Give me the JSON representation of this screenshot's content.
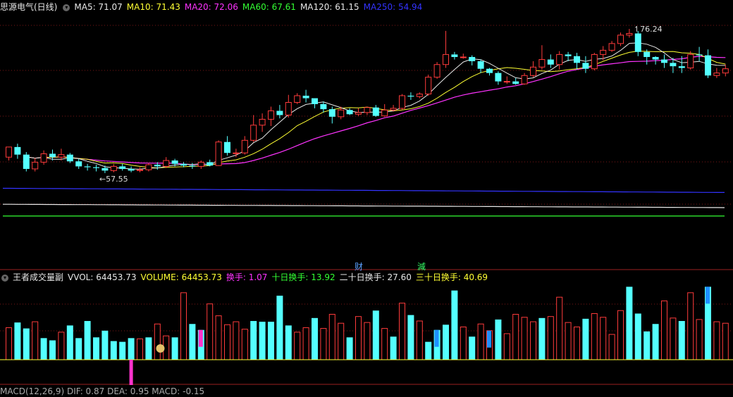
{
  "header": {
    "title": "思源电气(日线)",
    "ma": [
      {
        "label": "MA5: 71.07",
        "color": "#e8e8e8"
      },
      {
        "label": "MA10: 71.43",
        "color": "#ffff33"
      },
      {
        "label": "MA20: 72.06",
        "color": "#ff33ff"
      },
      {
        "label": "MA60: 67.61",
        "color": "#33ff33"
      },
      {
        "label": "MA120: 61.15",
        "color": "#e8e8e8"
      },
      {
        "label": "MA250: 54.94",
        "color": "#3333ff"
      }
    ]
  },
  "indicator": {
    "name": "王者成交量副",
    "items": [
      {
        "label": "VVOL: 64453.73",
        "color": "#e8e8e8"
      },
      {
        "label": "VOLUME: 64453.73",
        "color": "#ffff33"
      },
      {
        "label": "换手: 1.07",
        "color": "#ff33ff"
      },
      {
        "label": "十日换手: 13.92",
        "color": "#33ff33"
      },
      {
        "label": "二十日换手: 27.60",
        "color": "#e8e8e8"
      },
      {
        "label": "三十日换手: 40.69",
        "color": "#ffff33"
      }
    ]
  },
  "bottom": {
    "label": "MACD(12,26,9)  DIF: 0.87  DEA: 0.95  MACD: -0.15"
  },
  "markers": {
    "cai": "财",
    "jian": "減"
  },
  "colors": {
    "up": "#ff3b3b",
    "down": "#54ffff",
    "grid": "#7a1616",
    "pink": "#ff33cc",
    "blue": "#1e90ff"
  },
  "chart_data": {
    "type": "candlestick",
    "annotations": {
      "high": "76.24",
      "low": "57.55"
    },
    "candles": [
      [
        61.0,
        62.2,
        60.6,
        61.5
      ],
      [
        62.2,
        61.3,
        60.8,
        62.6
      ],
      [
        61.3,
        59.6,
        59.3,
        61.6
      ],
      [
        59.6,
        60.4,
        59.3,
        60.9
      ],
      [
        60.4,
        61.4,
        60.1,
        61.8
      ],
      [
        61.4,
        61.0,
        60.6,
        61.9
      ],
      [
        61.0,
        61.3,
        60.6,
        62.0
      ],
      [
        61.3,
        60.5,
        60.3,
        61.5
      ],
      [
        60.5,
        59.9,
        59.6,
        60.8
      ],
      [
        59.9,
        59.8,
        59.4,
        60.2
      ],
      [
        59.8,
        59.7,
        59.3,
        60.1
      ],
      [
        59.7,
        59.4,
        59.1,
        60.0
      ],
      [
        59.4,
        59.9,
        59.2,
        60.2
      ],
      [
        59.9,
        59.6,
        59.4,
        60.2
      ],
      [
        59.6,
        59.4,
        59.2,
        59.9
      ],
      [
        59.4,
        59.5,
        59.2,
        59.8
      ],
      [
        59.5,
        60.1,
        59.3,
        60.3
      ],
      [
        60.1,
        59.9,
        59.5,
        60.4
      ],
      [
        59.9,
        60.6,
        59.7,
        61.0
      ],
      [
        60.6,
        60.2,
        59.9,
        60.8
      ],
      [
        60.2,
        60.0,
        59.8,
        60.4
      ],
      [
        60.0,
        59.9,
        59.6,
        60.3
      ],
      [
        59.9,
        60.4,
        59.6,
        60.6
      ],
      [
        60.4,
        60.0,
        59.9,
        60.7
      ],
      [
        60.0,
        62.8,
        60.0,
        63.0
      ],
      [
        62.8,
        61.5,
        61.2,
        63.5
      ],
      [
        61.5,
        61.5,
        61.0,
        62.0
      ],
      [
        61.5,
        63.0,
        61.3,
        63.5
      ],
      [
        63.0,
        64.8,
        62.8,
        66.0
      ],
      [
        64.8,
        65.5,
        64.0,
        66.2
      ],
      [
        65.5,
        66.5,
        64.7,
        67.0
      ],
      [
        66.5,
        66.0,
        65.6,
        67.2
      ],
      [
        66.0,
        67.5,
        65.7,
        68.4
      ],
      [
        67.5,
        68.3,
        67.3,
        68.6
      ],
      [
        68.3,
        68.0,
        67.5,
        69.0
      ],
      [
        68.0,
        67.3,
        66.8,
        67.8
      ],
      [
        67.3,
        66.7,
        66.3,
        67.6
      ],
      [
        66.7,
        65.8,
        65.0,
        67.0
      ],
      [
        65.8,
        66.6,
        65.5,
        67.0
      ],
      [
        66.6,
        66.1,
        66.0,
        66.8
      ],
      [
        66.1,
        66.3,
        65.9,
        66.8
      ],
      [
        66.3,
        66.9,
        66.0,
        67.0
      ],
      [
        66.9,
        65.9,
        65.8,
        67.2
      ],
      [
        65.9,
        66.6,
        65.8,
        67.3
      ],
      [
        66.6,
        66.8,
        66.4,
        67.2
      ],
      [
        66.8,
        68.3,
        66.6,
        68.5
      ],
      [
        68.3,
        68.2,
        67.8,
        68.7
      ],
      [
        68.2,
        68.5,
        68.0,
        68.7
      ],
      [
        68.5,
        70.5,
        68.3,
        70.8
      ],
      [
        70.5,
        72.0,
        70.3,
        72.3
      ],
      [
        72.0,
        73.2,
        71.6,
        76.0
      ],
      [
        73.2,
        72.9,
        72.6,
        73.5
      ],
      [
        72.9,
        72.9,
        72.7,
        73.3
      ],
      [
        72.9,
        72.4,
        71.9,
        73.1
      ],
      [
        72.4,
        71.5,
        71.0,
        72.6
      ],
      [
        71.5,
        71.0,
        70.7,
        71.6
      ],
      [
        71.0,
        70.0,
        69.6,
        71.2
      ],
      [
        70.0,
        70.0,
        69.7,
        70.6
      ],
      [
        70.0,
        69.7,
        69.6,
        70.4
      ],
      [
        69.7,
        70.7,
        69.6,
        71.0
      ],
      [
        70.7,
        71.7,
        70.5,
        72.4
      ],
      [
        71.7,
        72.6,
        71.4,
        74.3
      ],
      [
        72.6,
        72.0,
        71.6,
        73.2
      ],
      [
        72.0,
        73.2,
        71.4,
        73.6
      ],
      [
        73.2,
        73.0,
        72.4,
        73.5
      ],
      [
        73.0,
        72.2,
        71.4,
        73.4
      ],
      [
        72.2,
        71.5,
        71.0,
        73.0
      ],
      [
        71.5,
        73.2,
        71.3,
        73.4
      ],
      [
        73.2,
        73.7,
        72.5,
        74.2
      ],
      [
        73.7,
        74.5,
        73.5,
        74.8
      ],
      [
        74.5,
        75.5,
        74.2,
        75.8
      ],
      [
        75.5,
        75.7,
        75.2,
        76.24
      ],
      [
        75.7,
        73.5,
        73.0,
        76.0
      ],
      [
        73.5,
        72.9,
        72.0,
        73.8
      ],
      [
        72.9,
        72.6,
        72.0,
        73.0
      ],
      [
        72.6,
        72.2,
        71.6,
        73.2
      ],
      [
        72.2,
        71.8,
        71.0,
        72.8
      ],
      [
        71.8,
        71.6,
        71.0,
        73.0
      ],
      [
        71.6,
        73.2,
        71.4,
        73.6
      ],
      [
        73.2,
        73.1,
        72.4,
        74.1
      ],
      [
        73.1,
        70.7,
        70.4,
        73.8
      ],
      [
        70.7,
        71.0,
        70.4,
        71.6
      ],
      [
        71.0,
        71.5,
        70.6,
        72.0
      ]
    ],
    "volume": [
      [
        4.3,
        1
      ],
      [
        5.0,
        0
      ],
      [
        4.2,
        0
      ],
      [
        5.1,
        1
      ],
      [
        2.9,
        0
      ],
      [
        2.6,
        0
      ],
      [
        3.7,
        1
      ],
      [
        4.6,
        0
      ],
      [
        2.9,
        0
      ],
      [
        5.2,
        0
      ],
      [
        3.0,
        0
      ],
      [
        3.9,
        0
      ],
      [
        2.5,
        0
      ],
      [
        2.4,
        0
      ],
      [
        2.9,
        0
      ],
      [
        2.8,
        1
      ],
      [
        3.0,
        0
      ],
      [
        4.8,
        1
      ],
      [
        3.2,
        1
      ],
      [
        3.0,
        0
      ],
      [
        9.0,
        1
      ],
      [
        4.8,
        0
      ],
      [
        4.0,
        0
      ],
      [
        7.5,
        1
      ],
      [
        5.9,
        1
      ],
      [
        4.7,
        1
      ],
      [
        5.1,
        1
      ],
      [
        4.1,
        1
      ],
      [
        5.2,
        0
      ],
      [
        5.1,
        0
      ],
      [
        5.1,
        0
      ],
      [
        8.6,
        0
      ],
      [
        4.6,
        0
      ],
      [
        3.7,
        1
      ],
      [
        4.3,
        1
      ],
      [
        5.6,
        0
      ],
      [
        4.2,
        1
      ],
      [
        6.1,
        1
      ],
      [
        4.9,
        1
      ],
      [
        3.0,
        0
      ],
      [
        5.8,
        1
      ],
      [
        5.0,
        1
      ],
      [
        6.6,
        0
      ],
      [
        4.2,
        1
      ],
      [
        3.1,
        0
      ],
      [
        7.6,
        1
      ],
      [
        6.0,
        0
      ],
      [
        5.2,
        1
      ],
      [
        2.4,
        0
      ],
      [
        4.0,
        0
      ],
      [
        4.7,
        0
      ],
      [
        9.3,
        0
      ],
      [
        4.4,
        1
      ],
      [
        3.1,
        0
      ],
      [
        4.8,
        1
      ],
      [
        3.9,
        1
      ],
      [
        5.4,
        0
      ],
      [
        3.5,
        1
      ],
      [
        6.1,
        1
      ],
      [
        5.7,
        1
      ],
      [
        5.1,
        1
      ],
      [
        5.6,
        0
      ],
      [
        5.8,
        1
      ],
      [
        8.4,
        1
      ],
      [
        5.0,
        1
      ],
      [
        4.4,
        1
      ],
      [
        5.5,
        0
      ],
      [
        6.2,
        1
      ],
      [
        5.7,
        1
      ],
      [
        3.4,
        1
      ],
      [
        6.6,
        1
      ],
      [
        9.8,
        0
      ],
      [
        6.2,
        0
      ],
      [
        3.8,
        0
      ],
      [
        4.8,
        0
      ],
      [
        7.9,
        1
      ],
      [
        5.6,
        1
      ],
      [
        5.2,
        0
      ],
      [
        9.0,
        1
      ],
      [
        5.4,
        1
      ],
      [
        9.8,
        0
      ],
      [
        5.1,
        1
      ],
      [
        4.9,
        1
      ]
    ],
    "price_axis": [
      56.0,
      78.0
    ],
    "volume_axis": [
      0,
      10.5
    ],
    "legend": "top-left"
  }
}
